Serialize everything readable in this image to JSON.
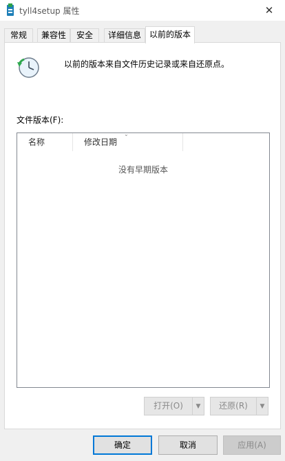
{
  "window": {
    "title": "tyll4setup 属性",
    "close_glyph": "✕"
  },
  "tabs": [
    {
      "label": "常规"
    },
    {
      "label": "兼容性"
    },
    {
      "label": "安全"
    },
    {
      "label": "详细信息"
    },
    {
      "label": "以前的版本",
      "active": true
    }
  ],
  "panel": {
    "description": "以前的版本来自文件历史记录或来自还原点。",
    "versions_label": "文件版本(F):",
    "columns": [
      "名称",
      "修改日期"
    ],
    "empty_message": "没有早期版本",
    "open_button": "打开(O)",
    "restore_button": "还原(R)"
  },
  "footer": {
    "ok": "确定",
    "cancel": "取消",
    "apply": "应用(A)"
  },
  "colors": {
    "accent": "#0078d7",
    "dialog_bg": "#f0f0f0",
    "panel_bg": "#ffffff"
  },
  "icons": {
    "app": "setup-package-icon",
    "history": "clock-restore-icon",
    "close": "close-icon",
    "dropdown": "chevron-down-icon"
  }
}
